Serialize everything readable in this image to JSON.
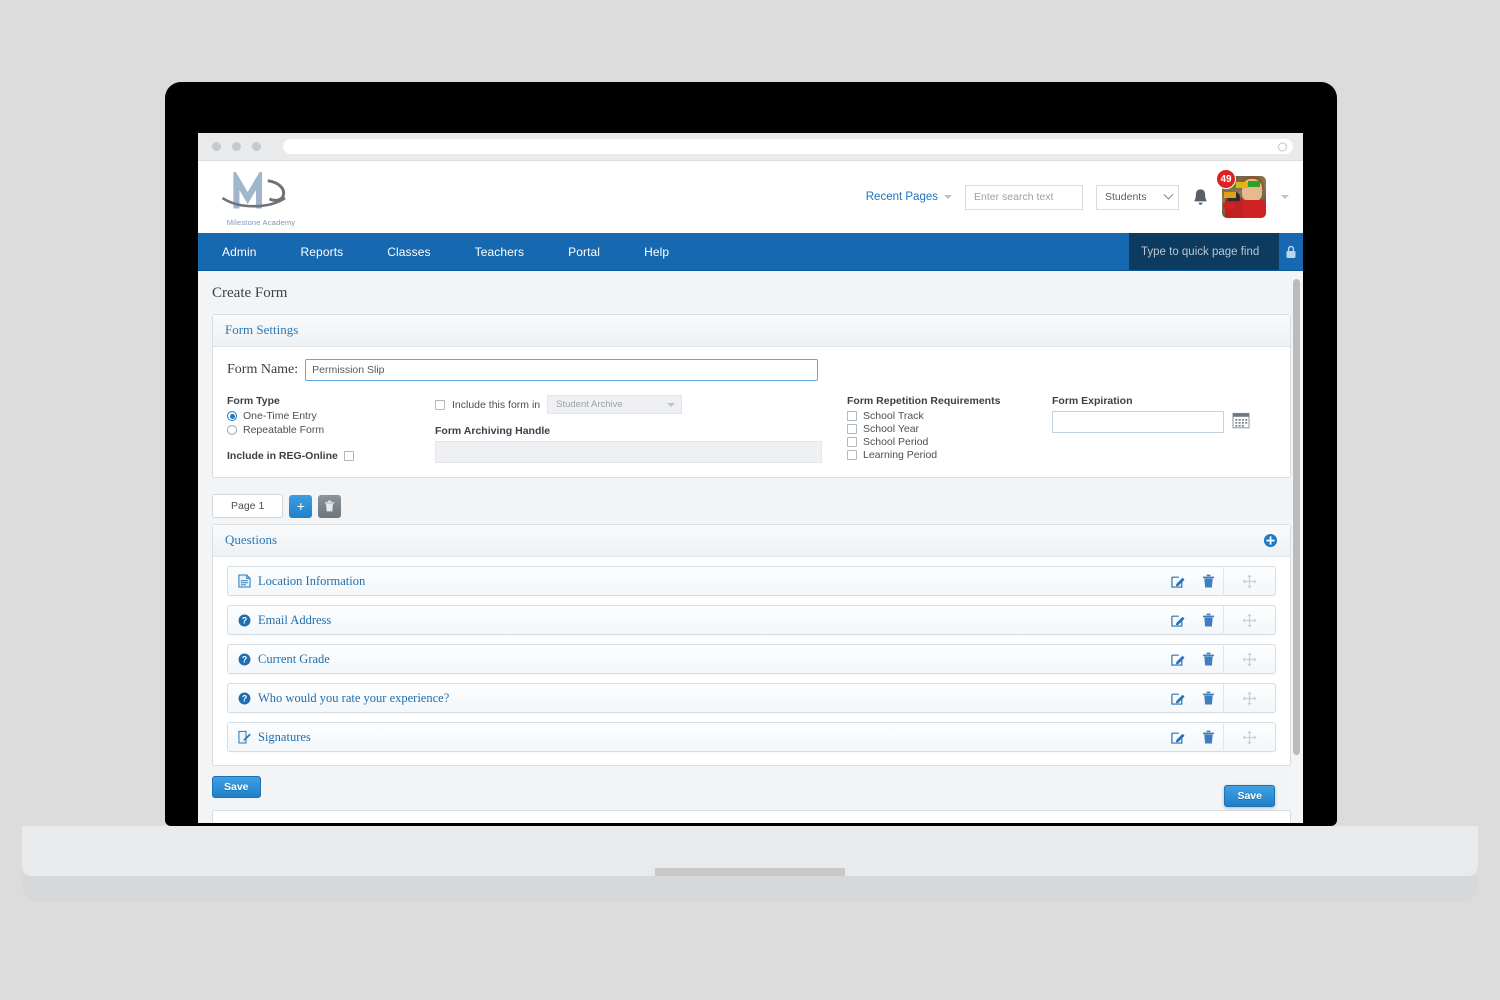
{
  "browser": {
    "url_value": "",
    "url_placeholder": "",
    "reload_icon": "reload-icon"
  },
  "header": {
    "logo_caption": "Milestone Academy",
    "recent_pages_label": "Recent Pages",
    "search_placeholder": "Enter search text",
    "search_value": "",
    "search_icon": "search-icon",
    "scope_select_value": "Students",
    "notifications_icon": "bell-icon",
    "notification_count": "49",
    "avatar_icon": "avatar",
    "account_caret_icon": "chevron-down-icon"
  },
  "nav": {
    "items": [
      {
        "label": "Admin"
      },
      {
        "label": "Reports"
      },
      {
        "label": "Classes"
      },
      {
        "label": "Teachers"
      },
      {
        "label": "Portal"
      },
      {
        "label": "Help"
      }
    ],
    "quick_find_placeholder": "Type to quick page find",
    "lock_icon": "lock-icon"
  },
  "page": {
    "title": "Create Form"
  },
  "form_settings": {
    "panel_title": "Form Settings",
    "form_name_label": "Form Name:",
    "form_name_value": "Permission Slip",
    "form_name_placeholder": "",
    "form_type_label": "Form Type",
    "form_type_options": [
      {
        "label": "One-Time Entry",
        "selected": true
      },
      {
        "label": "Repeatable Form",
        "selected": false
      }
    ],
    "include_reg_online_label": "Include in REG-Online",
    "include_reg_online_checked": false,
    "include_form_in_label": "Include this form in",
    "include_form_in_checked": false,
    "archive_select_value": "Student Archive",
    "archiving_handle_label": "Form Archiving Handle",
    "archiving_handle_value": "",
    "repetition_label": "Form Repetition Requirements",
    "repetition_options": [
      {
        "label": "School Track",
        "checked": false
      },
      {
        "label": "School Year",
        "checked": false
      },
      {
        "label": "School Period",
        "checked": false
      },
      {
        "label": "Learning Period",
        "checked": false
      }
    ],
    "expiration_label": "Form Expiration",
    "expiration_value": "",
    "calendar_icon": "calendar-icon"
  },
  "pages": {
    "tabs": [
      {
        "label": "Page 1",
        "active": true
      }
    ],
    "add_page_label": "+",
    "add_page_icon": "plus-icon",
    "delete_page_icon": "trash-icon"
  },
  "questions": {
    "panel_title": "Questions",
    "add_question_icon": "plus-circle-icon",
    "edit_icon": "edit-icon",
    "delete_icon": "trash-icon",
    "drag_icon": "move-arrows-icon",
    "items": [
      {
        "label": "Location Information",
        "icon": "document-icon"
      },
      {
        "label": "Email Address",
        "icon": "question-circle-icon"
      },
      {
        "label": "Current Grade",
        "icon": "question-circle-icon"
      },
      {
        "label": "Who would you rate your experience?",
        "icon": "question-circle-icon"
      },
      {
        "label": "Signatures",
        "icon": "signature-icon"
      }
    ]
  },
  "actions": {
    "save_label": "Save",
    "floating_save_label": "Save"
  },
  "colors": {
    "nav_blue": "#1669b0",
    "quickfind_blue": "#0c3b5f",
    "link_blue": "#1f6fb0",
    "badge_red": "#e02020",
    "button_blue": "#2081c8"
  }
}
